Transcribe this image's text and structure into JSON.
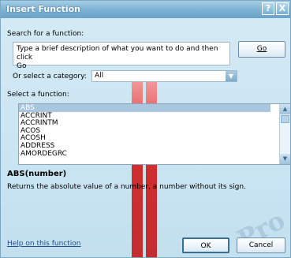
{
  "window": {
    "title": "Insert Function",
    "help_glyph": "?",
    "close_glyph": "X"
  },
  "search": {
    "label": "Search for a function:",
    "text_line1": "Type a brief description of what you want to do and then click",
    "text_line2": "Go",
    "go_label": "Go"
  },
  "category": {
    "label": "Or select a category:",
    "value": "All",
    "dropdown_glyph": "▼"
  },
  "functions": {
    "label": "Select a function:",
    "items": [
      "ABS",
      "ACCRINT",
      "ACCRINTM",
      "ACOS",
      "ACOSH",
      "ADDRESS",
      "AMORDEGRC"
    ],
    "selected_index": 0
  },
  "details": {
    "signature": "ABS(number)",
    "description": "Returns the absolute value of a number, a number without its sign."
  },
  "footer": {
    "help_link": "Help on this function",
    "ok_label": "OK",
    "cancel_label": "Cancel"
  },
  "watermark": {
    "text": "Pro"
  },
  "colors": {
    "titlebar": "#7fb3d4",
    "dialog_bg": "#cbe5f2",
    "selection": "#a8c7df",
    "watermark_red": "#d40000"
  }
}
